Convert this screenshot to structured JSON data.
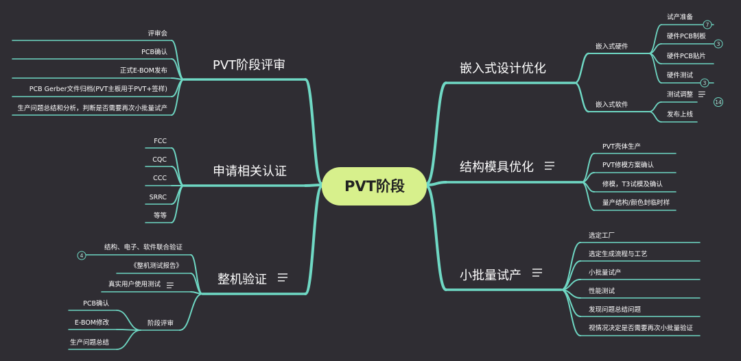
{
  "colors": {
    "background": "#2f2d33",
    "line": "#6fd8c4",
    "root_fill": "#d7f08c",
    "root_text": "#222222",
    "text": "#ffffff"
  },
  "root": {
    "label": "PVT阶段"
  },
  "branches": {
    "embedded": {
      "label": "嵌入式设计优化",
      "hardware": {
        "label": "嵌入式硬件",
        "items": [
          "试产准备",
          "硬件PCB制板",
          "硬件PCB贴片",
          "硬件测试"
        ]
      },
      "software": {
        "label": "嵌入式软件",
        "items": [
          "测试调整",
          "发布上线"
        ]
      }
    },
    "structure": {
      "label": "结构模具优化",
      "items": [
        "PVT壳体生产",
        "PVT修模方案确认",
        "修模，T3试模及确认",
        "量产结构/颜色封临时样"
      ]
    },
    "trial": {
      "label": "小批量试产",
      "items": [
        "选定工厂",
        "选定生成流程与工艺",
        "小批量试产",
        "性能测试",
        "发现问题总结问题",
        "视情况决定是否需要再次小批量验证"
      ]
    },
    "review": {
      "label": "PVT阶段评审",
      "items": [
        "评审会",
        "PCB确认",
        "正式E-BOM发布",
        "PCB Gerber文件归档(PVT主板用于PVT+签样)",
        "生产问题总结和分析，判断是否需要再次小批量试产"
      ]
    },
    "cert": {
      "label": "申请相关认证",
      "items": [
        "FCC",
        "CQC",
        "CCC",
        "SRRC",
        "等等"
      ]
    },
    "verify": {
      "label": "整机验证",
      "items": [
        "结构、电子、软件联合验证",
        "《整机测试报告》",
        "真实用户使用测试"
      ],
      "stage": {
        "label": "阶段评审",
        "items": [
          "PCB确认",
          "E-BOM修改",
          "生产问题总结"
        ]
      }
    }
  },
  "badges": {
    "prep": "7",
    "pcb_make": "3",
    "hw_test": "3",
    "sw_test": "14",
    "joint": "4"
  }
}
